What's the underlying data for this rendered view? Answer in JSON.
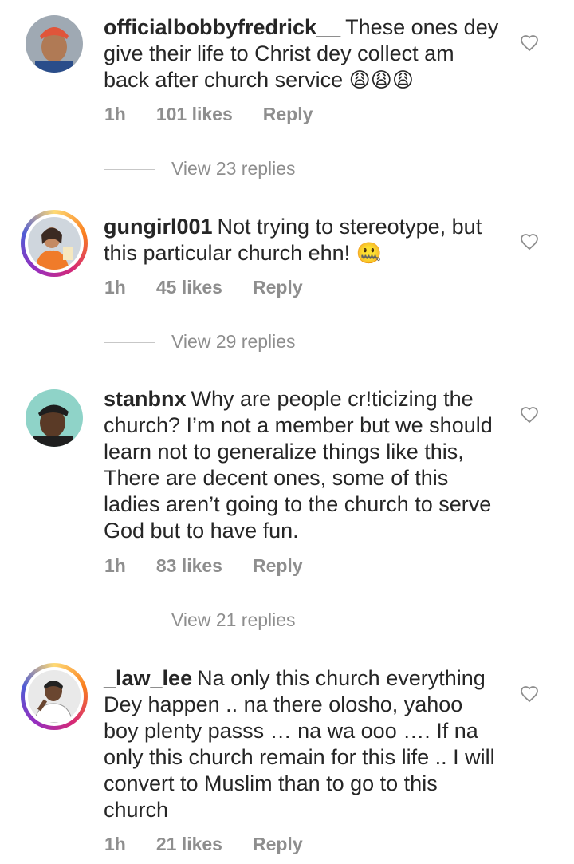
{
  "comments": [
    {
      "username": "officialbobbyfredrick__",
      "text": "These ones dey give their life to Christ dey collect am back after church service",
      "emoji": "😩😩😩",
      "time": "1h",
      "likes": "101 likes",
      "reply": "Reply",
      "view_replies": "View 23 replies",
      "has_story_ring": false
    },
    {
      "username": "gungirl001",
      "text": "Not trying to stereotype, but this particular church ehn!",
      "emoji": "🤐",
      "time": "1h",
      "likes": "45 likes",
      "reply": "Reply",
      "view_replies": "View 29 replies",
      "has_story_ring": true
    },
    {
      "username": "stanbnx",
      "text": "Why are people cr!ticizing the church? I’m not a member but we should learn not to generalize things like this, There are decent ones, some of this ladies aren’t going to the church to serve God but to have fun.",
      "emoji": "",
      "time": "1h",
      "likes": "83 likes",
      "reply": "Reply",
      "view_replies": "View 21 replies",
      "has_story_ring": false
    },
    {
      "username": "_law_lee",
      "text": "Na only this church everything Dey happen .. na there olosho, yahoo boy plenty passs … na wa ooo …. If na only this church remain for this life .. I will convert to Muslim than to go to this church",
      "emoji": "",
      "time": "1h",
      "likes": "21 likes",
      "reply": "Reply",
      "view_replies": "",
      "has_story_ring": true
    }
  ],
  "icons": {
    "like": "heart-outline-icon"
  },
  "colors": {
    "secondary_text": "#8e8e8e",
    "primary_text": "#262626"
  }
}
